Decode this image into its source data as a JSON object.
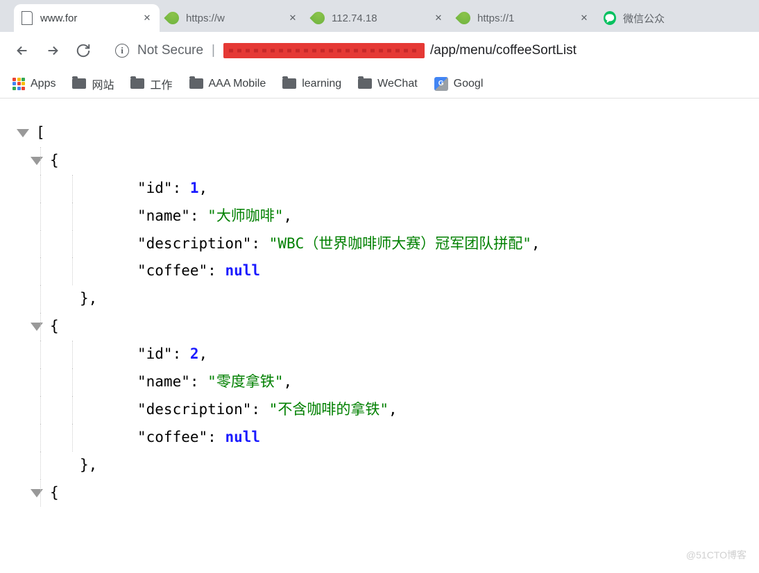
{
  "tabs": [
    {
      "title": "www.for",
      "type": "file"
    },
    {
      "title": "https://w",
      "type": "spring"
    },
    {
      "title": "112.74.18",
      "type": "spring"
    },
    {
      "title": "https://1",
      "type": "spring"
    },
    {
      "title": "微信公众",
      "type": "wechat"
    }
  ],
  "addressBar": {
    "notSecure": "Not Secure",
    "urlPath": "/app/menu/coffeeSortList"
  },
  "bookmarks": {
    "apps": "Apps",
    "folders": [
      "网站",
      "工作",
      "AAA Mobile",
      "learning",
      "WeChat"
    ],
    "google": "Googl"
  },
  "json": {
    "items": [
      {
        "id": 1,
        "name": "大师咖啡",
        "description": "WBC（世界咖啡师大赛）冠军团队拼配",
        "coffee": "null"
      },
      {
        "id": 2,
        "name": "零度拿铁",
        "description": "不含咖啡的拿铁",
        "coffee": "null"
      }
    ],
    "keys": {
      "id": "\"id\"",
      "name": "\"name\"",
      "description": "\"description\"",
      "coffee": "\"coffee\""
    }
  },
  "watermark": "@51CTO博客"
}
